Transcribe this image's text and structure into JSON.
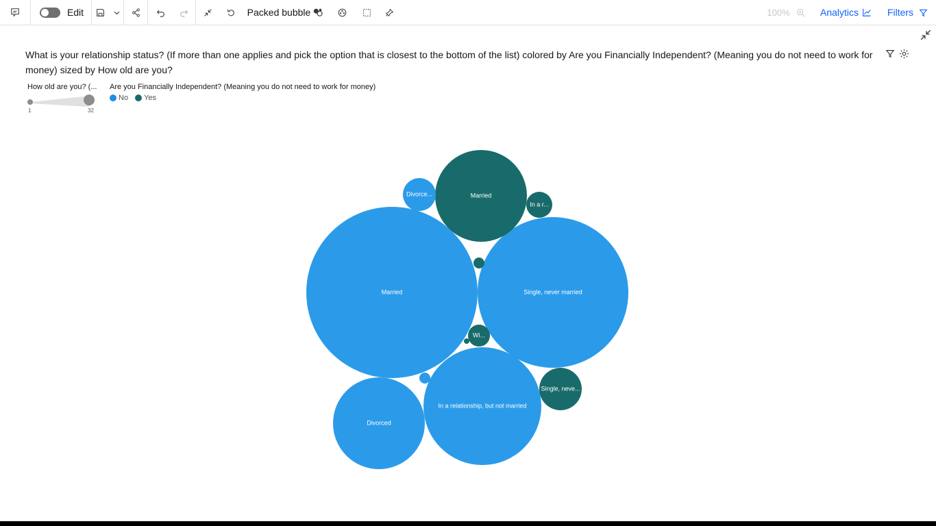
{
  "toolbar": {
    "edit_label": "Edit",
    "viz_type_label": "Packed bubble",
    "zoom_label": "100%",
    "analytics_label": "Analytics",
    "filters_label": "Filters"
  },
  "title": "What is your relationship status?  (If more than one applies and pick the option that is closest to the bottom of the list) colored by Are you Financially Independent? (Meaning you do not need to work for money) sized by How old are you?",
  "legend": {
    "size_label": "How old are you? (...",
    "size_min": "1",
    "size_max": "32",
    "color_label": "Are you Financially Independent? (Meaning you do not need to work for money)",
    "items": [
      {
        "label": "No",
        "color": "#2b9be9"
      },
      {
        "label": "Yes",
        "color": "#196b6b"
      }
    ]
  },
  "colors": {
    "No": "#2b9be9",
    "Yes": "#196b6b",
    "accent": "#0f62fe"
  },
  "chart_data": {
    "type": "packed bubble",
    "color_by": "Are you Financially Independent? (Meaning you do not need to work for money)",
    "size_by": "How old are you?",
    "size_range": [
      1,
      32
    ],
    "bubbles": [
      {
        "category": "Married",
        "group": "No",
        "label": "Married"
      },
      {
        "category": "Single, never married",
        "group": "No",
        "label": "Single, never married"
      },
      {
        "category": "In a relationship, but not married",
        "group": "No",
        "label": "In a relationship, but not married"
      },
      {
        "category": "Divorced",
        "group": "No",
        "label": "Divorced"
      },
      {
        "category": "Married",
        "group": "Yes",
        "label": "Married"
      },
      {
        "category": "Divorced",
        "group": "No",
        "label": "Divorce..."
      },
      {
        "category": "In a relationship, but not married",
        "group": "Yes",
        "label": "In a r..."
      },
      {
        "category": "Single, never married",
        "group": "Yes",
        "label": "Single, neve..."
      },
      {
        "category": "Widowed",
        "group": "Yes",
        "label": "Wi..."
      },
      {
        "category": "",
        "group": "Yes",
        "label": ""
      },
      {
        "category": "",
        "group": "No",
        "label": ""
      },
      {
        "category": "",
        "group": "Yes",
        "label": ""
      }
    ]
  }
}
